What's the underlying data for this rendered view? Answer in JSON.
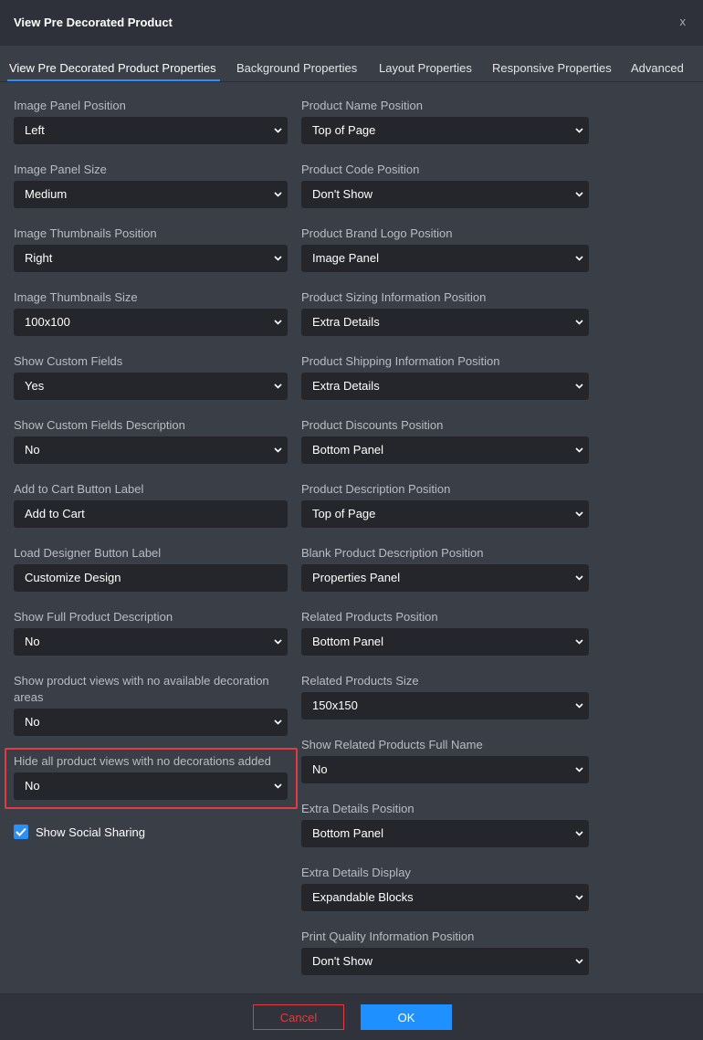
{
  "dialog": {
    "title": "View Pre Decorated Product",
    "close_label": "x"
  },
  "tabs": [
    {
      "label": "View Pre Decorated Product Properties",
      "active": true
    },
    {
      "label": "Background Properties"
    },
    {
      "label": "Layout Properties"
    },
    {
      "label": "Responsive Properties"
    },
    {
      "label": "Advanced"
    }
  ],
  "left_fields": [
    {
      "label": "Image Panel Position",
      "type": "select",
      "value": "Left"
    },
    {
      "label": "Image Panel Size",
      "type": "select",
      "value": "Medium"
    },
    {
      "label": "Image Thumbnails Position",
      "type": "select",
      "value": "Right"
    },
    {
      "label": "Image Thumbnails Size",
      "type": "select",
      "value": "100x100"
    },
    {
      "label": "Show Custom Fields",
      "type": "select",
      "value": "Yes"
    },
    {
      "label": "Show Custom Fields Description",
      "type": "select",
      "value": "No"
    },
    {
      "label": "Add to Cart Button Label",
      "type": "text",
      "value": "Add to Cart"
    },
    {
      "label": "Load Designer Button Label",
      "type": "text",
      "value": "Customize Design"
    },
    {
      "label": "Show Full Product Description",
      "type": "select",
      "value": "No"
    },
    {
      "label": "Show product views with no available decoration areas",
      "type": "select",
      "value": "No"
    },
    {
      "label": "Hide all product views with no decorations added",
      "type": "select",
      "value": "No",
      "highlighted": true
    }
  ],
  "show_social_sharing": {
    "label": "Show Social Sharing",
    "checked": true
  },
  "right_fields": [
    {
      "label": "Product Name Position",
      "value": "Top of Page"
    },
    {
      "label": "Product Code Position",
      "value": "Don't Show"
    },
    {
      "label": "Product Brand Logo Position",
      "value": "Image Panel"
    },
    {
      "label": "Product Sizing Information Position",
      "value": "Extra Details"
    },
    {
      "label": "Product Shipping Information Position",
      "value": "Extra Details"
    },
    {
      "label": "Product Discounts Position",
      "value": "Bottom Panel"
    },
    {
      "label": "Product Description Position",
      "value": "Top of Page"
    },
    {
      "label": "Blank Product Description Position",
      "value": "Properties Panel"
    },
    {
      "label": "Related Products Position",
      "value": "Bottom Panel"
    },
    {
      "label": "Related Products Size",
      "value": "150x150"
    },
    {
      "label": "Show Related Products Full Name",
      "value": "No"
    },
    {
      "label": "Extra Details Position",
      "value": "Bottom Panel"
    },
    {
      "label": "Extra Details Display",
      "value": "Expandable Blocks"
    },
    {
      "label": "Print Quality Information Position",
      "value": "Don't Show"
    }
  ],
  "footer": {
    "cancel_label": "Cancel",
    "ok_label": "OK"
  },
  "colors": {
    "accent": "#1e90ff",
    "danger": "#e23b41",
    "background": "#3a3e47",
    "input_background": "#24262b"
  }
}
